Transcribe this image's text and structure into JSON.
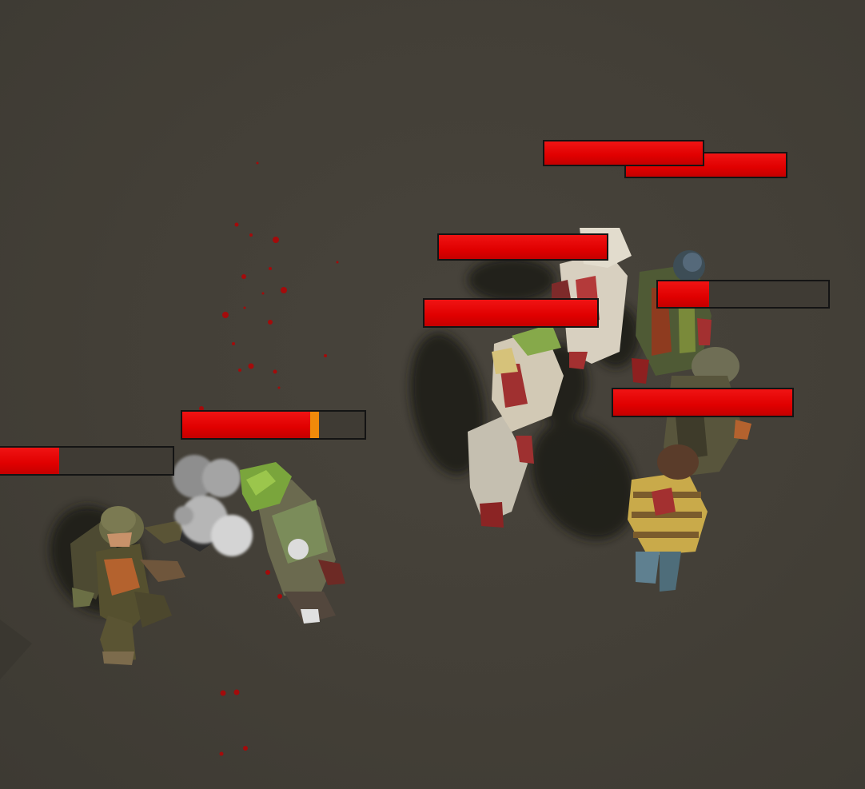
{
  "scene": {
    "ground_color": "#433f37",
    "blood_color": "#a30b0b",
    "player": {
      "name": "soldier",
      "health_fraction": 0.35
    },
    "enemies": [
      {
        "id": "zombie-green-cap",
        "health_fraction": 0.7,
        "recent_damage_fraction": 0.05
      },
      {
        "id": "zombie-back-1",
        "health_fraction": 1.0,
        "recent_damage_fraction": 0
      },
      {
        "id": "zombie-back-2",
        "health_fraction": 1.0,
        "recent_damage_fraction": 0
      },
      {
        "id": "zombie-white-dress",
        "health_fraction": 1.0,
        "recent_damage_fraction": 0
      },
      {
        "id": "zombie-clown",
        "health_fraction": 0.3,
        "recent_damage_fraction": 0
      },
      {
        "id": "zombie-pale",
        "health_fraction": 1.0,
        "recent_damage_fraction": 0
      },
      {
        "id": "zombie-helmet",
        "health_fraction": 1.0,
        "recent_damage_fraction": 0
      }
    ],
    "icons": [
      "smoke-cloud-icon",
      "blood-splatter-icon"
    ]
  }
}
